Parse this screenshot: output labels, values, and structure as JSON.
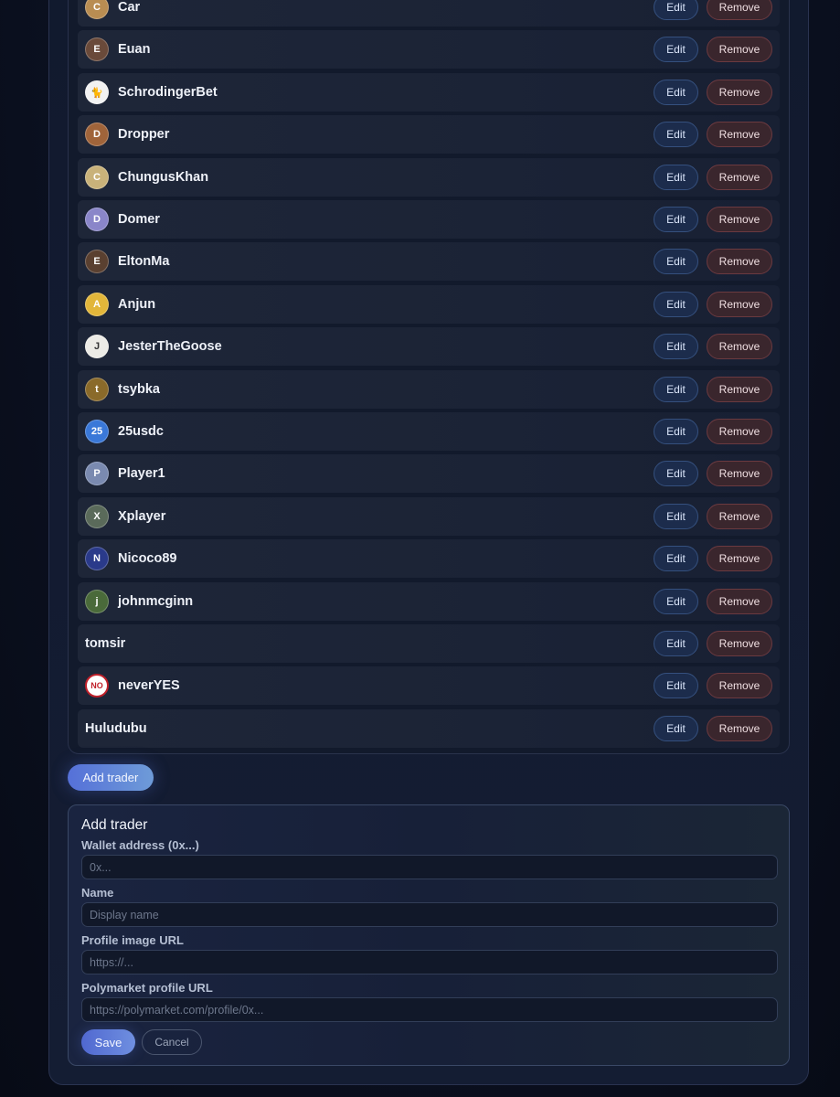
{
  "traders": [
    {
      "name": "Car",
      "has_avatar": true,
      "avatar_color": "#b98d52",
      "avatar_glyph": "C"
    },
    {
      "name": "Euan",
      "has_avatar": true,
      "avatar_color": "#6a4a3a",
      "avatar_glyph": "E"
    },
    {
      "name": "SchrodingerBet",
      "has_avatar": true,
      "avatar_color": "#f2f2f2",
      "avatar_glyph": "🐈"
    },
    {
      "name": "Dropper",
      "has_avatar": true,
      "avatar_color": "#a0643a",
      "avatar_glyph": "D"
    },
    {
      "name": "ChungusKhan",
      "has_avatar": true,
      "avatar_color": "#c9b27a",
      "avatar_glyph": "C"
    },
    {
      "name": "Domer",
      "has_avatar": true,
      "avatar_color": "#8a86c9",
      "avatar_glyph": "D"
    },
    {
      "name": "EltonMa",
      "has_avatar": true,
      "avatar_color": "#5a4030",
      "avatar_glyph": "E"
    },
    {
      "name": "Anjun",
      "has_avatar": true,
      "avatar_color": "#e2b63a",
      "avatar_glyph": "A"
    },
    {
      "name": "JesterTheGoose",
      "has_avatar": true,
      "avatar_color": "#ecebe6",
      "avatar_glyph": "J"
    },
    {
      "name": "tsybka",
      "has_avatar": true,
      "avatar_color": "#8a6a2a",
      "avatar_glyph": "t"
    },
    {
      "name": "25usdc",
      "has_avatar": true,
      "avatar_color": "#3a78d8",
      "avatar_glyph": "25"
    },
    {
      "name": "Player1",
      "has_avatar": true,
      "avatar_color": "#7a8ab0",
      "avatar_glyph": "P"
    },
    {
      "name": "Xplayer",
      "has_avatar": true,
      "avatar_color": "#5a6a5a",
      "avatar_glyph": "X"
    },
    {
      "name": "Nicoco89",
      "has_avatar": true,
      "avatar_color": "#2a3a8a",
      "avatar_glyph": "N"
    },
    {
      "name": "johnmcginn",
      "has_avatar": true,
      "avatar_color": "#4a6a3a",
      "avatar_glyph": "j"
    },
    {
      "name": "tomsir",
      "has_avatar": false,
      "avatar_color": "",
      "avatar_glyph": ""
    },
    {
      "name": "neverYES",
      "has_avatar": true,
      "avatar_color": "#ffffff",
      "avatar_glyph": "NO"
    },
    {
      "name": "Huludubu",
      "has_avatar": false,
      "avatar_color": "",
      "avatar_glyph": ""
    }
  ],
  "row_actions": {
    "edit_label": "Edit",
    "remove_label": "Remove"
  },
  "add_trader_button": "Add trader",
  "form": {
    "title": "Add trader",
    "wallet_label": "Wallet address (0x...)",
    "wallet_placeholder": "0x...",
    "name_label": "Name",
    "name_placeholder": "Display name",
    "image_label": "Profile image URL",
    "image_placeholder": "https://...",
    "polymarket_label": "Polymarket profile URL",
    "polymarket_placeholder": "https://polymarket.com/profile/0x...",
    "save_label": "Save",
    "cancel_label": "Cancel"
  }
}
